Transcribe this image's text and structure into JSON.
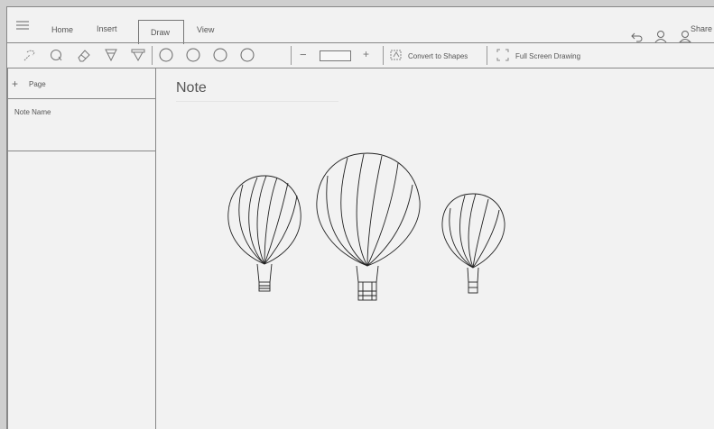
{
  "tabs": [
    {
      "label": "Home"
    },
    {
      "label": "Insert"
    },
    {
      "label": "Draw"
    },
    {
      "label": "View"
    }
  ],
  "header": {
    "share_label": "Share",
    "icons": [
      "menu-icon",
      "undo-icon",
      "person-icon",
      "share-person-icon"
    ]
  },
  "toolbar": {
    "tools": [
      "lasso-select-icon",
      "lasso-icon",
      "eraser-icon",
      "pen-icon",
      "highlighter-icon"
    ],
    "colors": [
      "color-circle-1",
      "color-circle-2",
      "color-circle-3",
      "color-circle-4"
    ],
    "thickness_minus": "−",
    "thickness_plus": "+",
    "convert_label": "Convert to Shapes",
    "fullscreen_label": "Full Screen Drawing"
  },
  "sidebar": {
    "add_page_label": "Page",
    "note_name": "Note Name"
  },
  "canvas": {
    "title": "Note"
  },
  "colors": {
    "background": "#f2f2f2",
    "border": "#888888",
    "text": "#555555"
  }
}
